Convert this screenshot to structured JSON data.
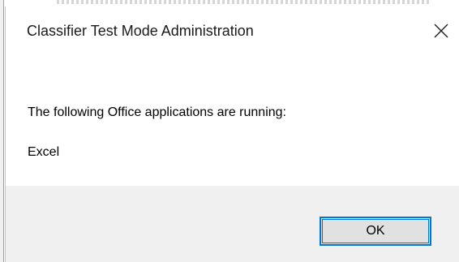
{
  "dialog": {
    "title": "Classifier Test Mode Administration",
    "message": "The following Office applications are running:",
    "applications": [
      "Excel"
    ],
    "ok_label": "OK",
    "close_icon": "close-icon"
  },
  "colors": {
    "accent": "#0078d7",
    "footer_background": "#f0f0f0",
    "button_background": "#e1e1e1"
  }
}
